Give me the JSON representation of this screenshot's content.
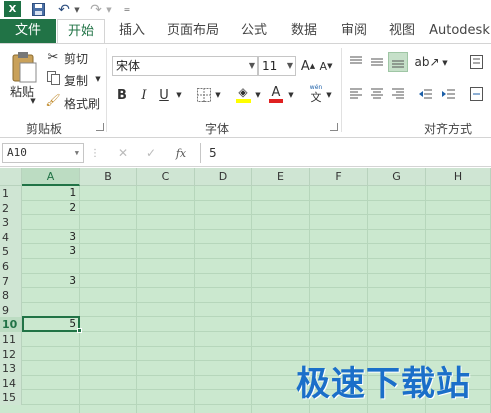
{
  "quick_access": {
    "logo": "X"
  },
  "tabs": [
    {
      "label": "文件"
    },
    {
      "label": "开始"
    },
    {
      "label": "插入"
    },
    {
      "label": "页面布局"
    },
    {
      "label": "公式"
    },
    {
      "label": "数据"
    },
    {
      "label": "审阅"
    },
    {
      "label": "视图"
    },
    {
      "label": "Autodesk"
    }
  ],
  "clipboard": {
    "paste_label": "粘贴",
    "cut_label": "剪切",
    "copy_label": "复制",
    "format_painter_label": "格式刷",
    "group_label": "剪贴板"
  },
  "font": {
    "font_name": "宋体",
    "font_size": "11",
    "grow_label": "A",
    "shrink_label": "A",
    "bold": "B",
    "italic": "I",
    "underline": "U",
    "font_color_letter": "A",
    "phonetic_top": "wén",
    "phonetic_bottom": "文",
    "group_label": "字体",
    "fill_color": "#ffff00",
    "font_color": "#e02020"
  },
  "alignment": {
    "group_label": "对齐方式"
  },
  "formula_bar": {
    "name_box": "A10",
    "fx_label": "fx",
    "value": "5"
  },
  "grid": {
    "columns": [
      "A",
      "B",
      "C",
      "D",
      "E",
      "F",
      "G",
      "H"
    ],
    "rows": [
      "1",
      "2",
      "3",
      "4",
      "5",
      "6",
      "7",
      "8",
      "9",
      "10",
      "11",
      "12",
      "13",
      "14",
      "15"
    ],
    "column_a_values": [
      "1",
      "2",
      "",
      "3",
      "3",
      "",
      "3",
      "",
      "",
      "5",
      "",
      "",
      "",
      "",
      ""
    ],
    "selected_cell": "A10"
  },
  "watermark": "极速下载站",
  "colors": {
    "brand": "#217346",
    "sheet_bg": "#cbe8cf"
  }
}
